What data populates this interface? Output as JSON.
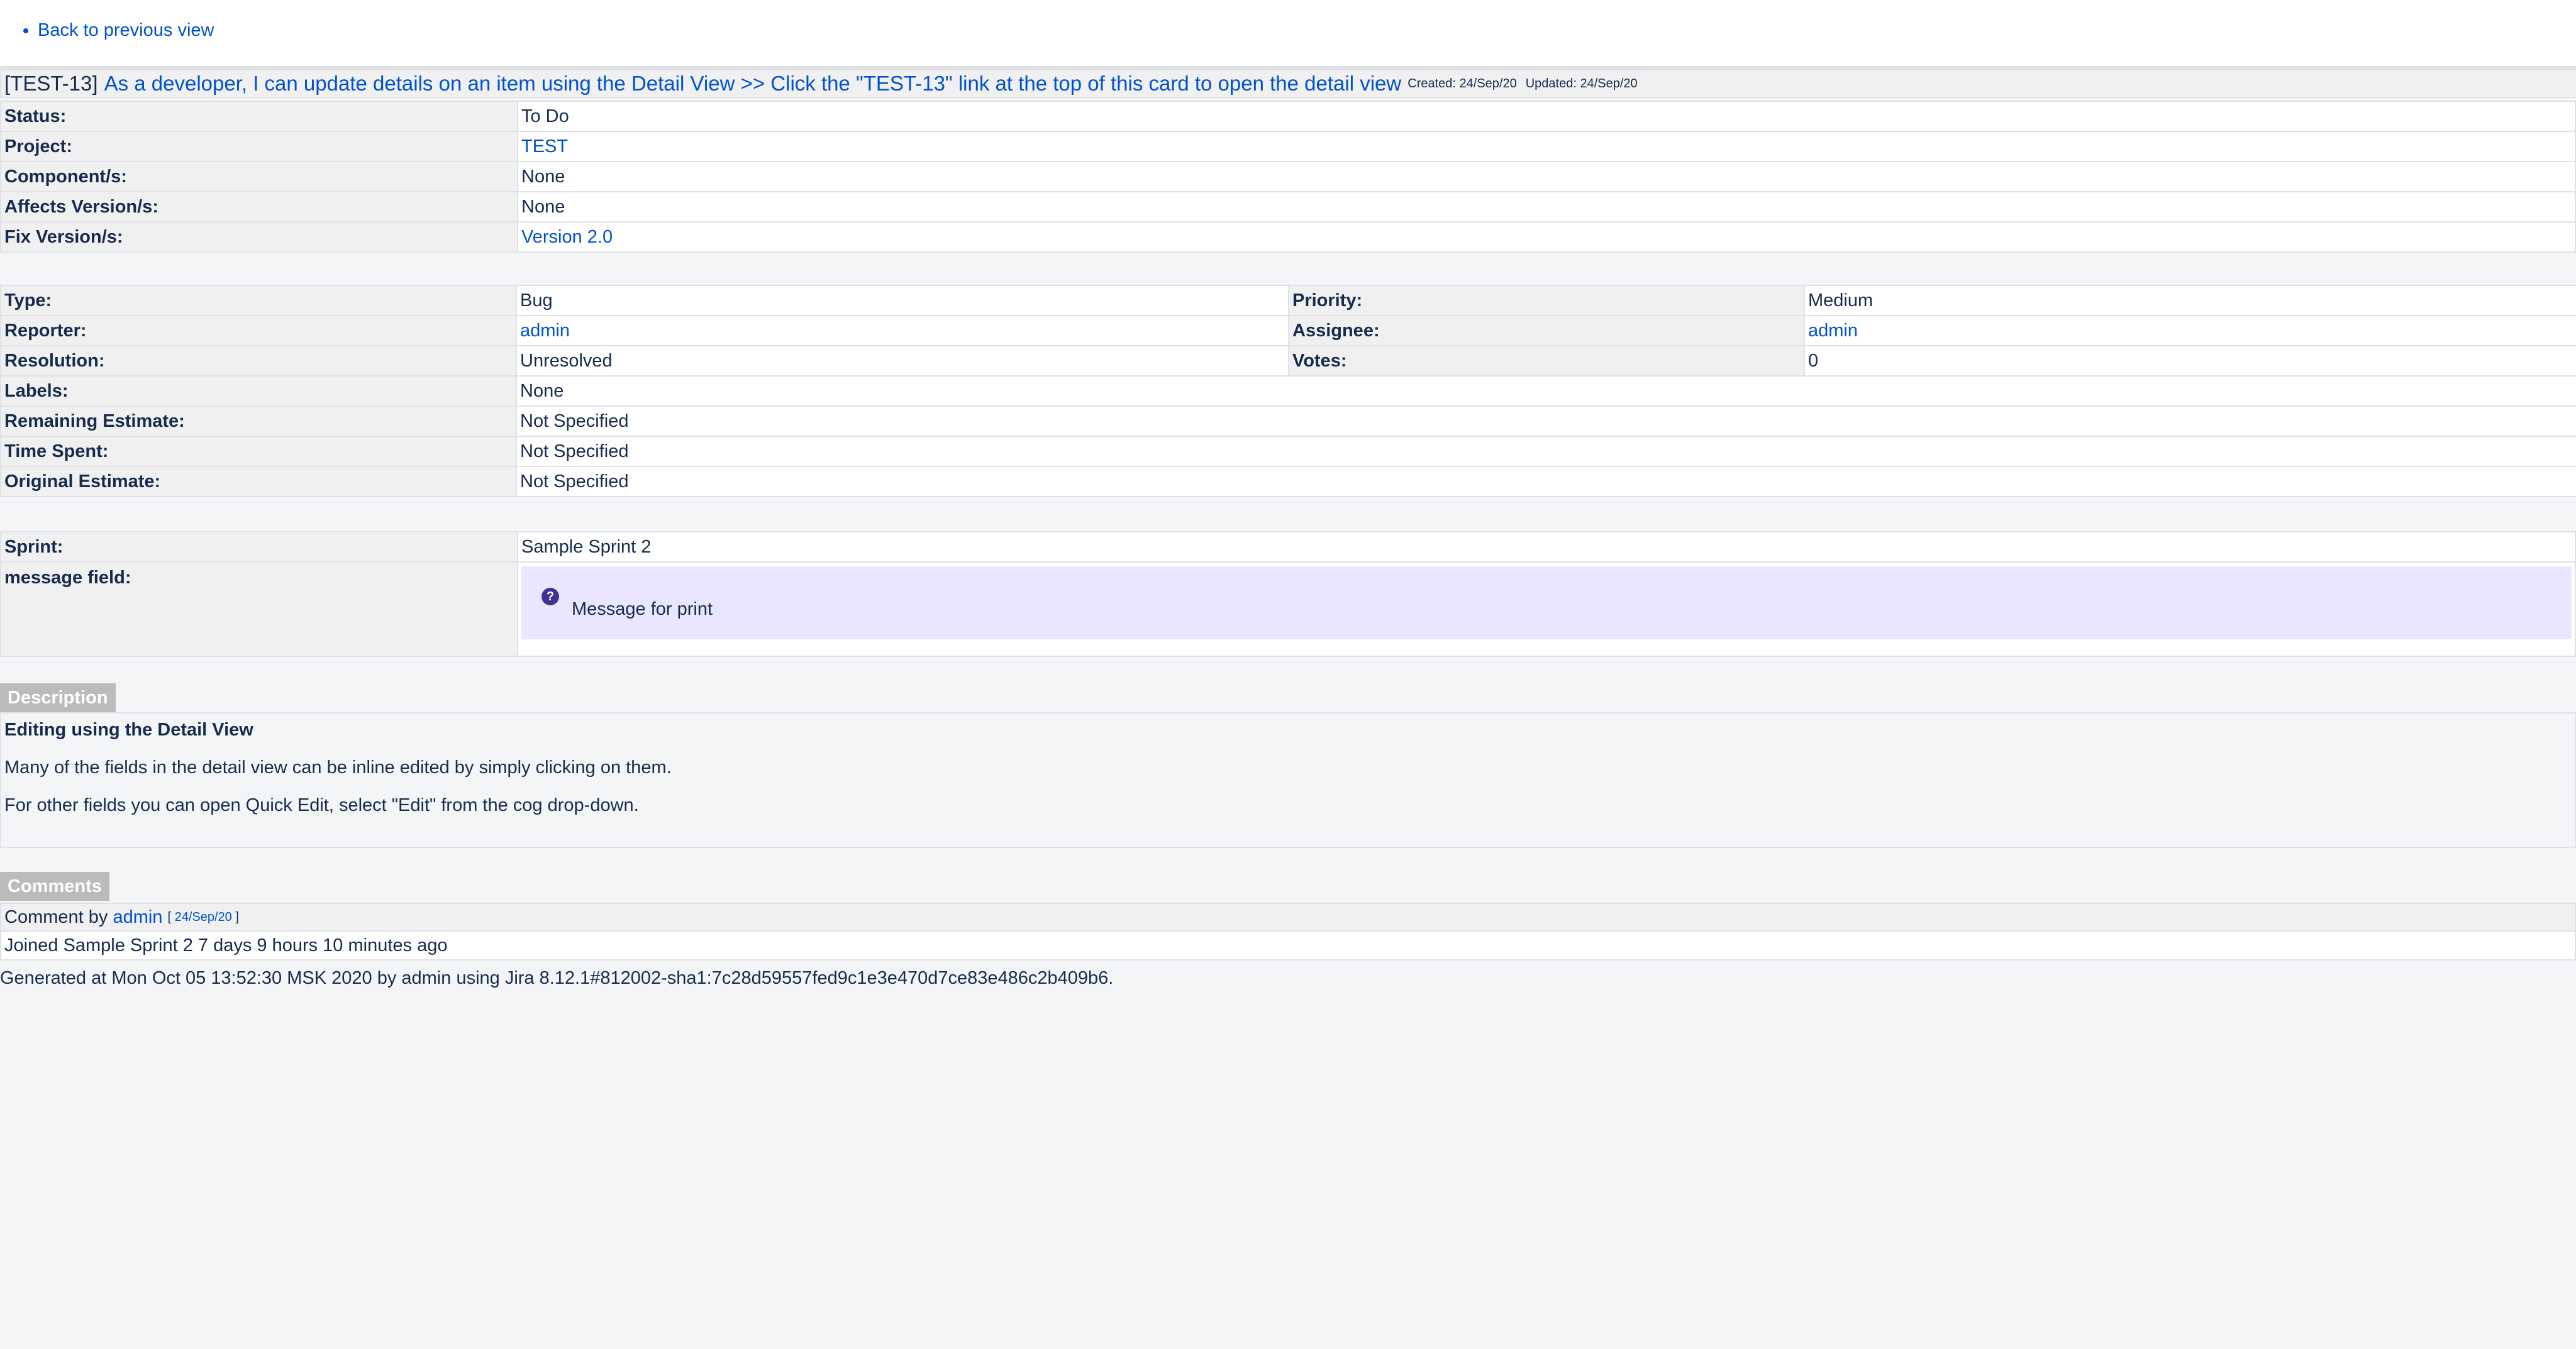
{
  "nav": {
    "back_label": "Back to previous view"
  },
  "issue": {
    "key": "[TEST-13]",
    "summary": "As a developer, I can update details on an item using the Detail View >> Click the \"TEST-13\" link at the top of this card to open the detail view",
    "created": "Created: 24/Sep/20",
    "updated": "Updated: 24/Sep/20"
  },
  "fields1": [
    {
      "label": "Status:",
      "value": "To Do"
    },
    {
      "label": "Project:",
      "value": "TEST"
    },
    {
      "label": "Component/s:",
      "value": "None"
    },
    {
      "label": "Affects Version/s:",
      "value": "None"
    },
    {
      "label": "Fix Version/s:",
      "value": "Version 2.0"
    }
  ],
  "fields2": {
    "type_label": "Type:",
    "type": "Bug",
    "priority_label": "Priority:",
    "priority": "Medium",
    "reporter_label": "Reporter:",
    "reporter": "admin",
    "assignee_label": "Assignee:",
    "assignee": "admin",
    "resolution_label": "Resolution:",
    "resolution": "Unresolved",
    "votes_label": "Votes:",
    "votes": "0",
    "labels_label": "Labels:",
    "labels": "None",
    "remaining_label": "Remaining Estimate:",
    "remaining": "Not Specified",
    "spent_label": "Time Spent:",
    "spent": "Not Specified",
    "original_label": "Original Estimate:",
    "original": "Not Specified"
  },
  "fields3": {
    "sprint_label": "Sprint:",
    "sprint": "Sample Sprint 2",
    "message_label": "message field:",
    "message_icon": "?",
    "message": "Message for print"
  },
  "description": {
    "tab": "Description",
    "heading": "Editing using the Detail View",
    "p1": "Many of the fields in the detail view can be inline edited by simply clicking on them.",
    "p2": "For other fields you can open Quick Edit, select \"Edit\" from the cog drop-down."
  },
  "comments": {
    "tab": "Comments",
    "by_label": "Comment by",
    "author": "admin",
    "open_bracket": "[",
    "date": "24/Sep/20",
    "close_bracket": "]",
    "body": "Joined Sample Sprint 2 7 days 9 hours 10 minutes ago"
  },
  "footer": "Generated at Mon Oct 05 13:52:30 MSK 2020 by admin using Jira 8.12.1#812002-sha1:7c28d59557fed9c1e3e470d7ce83e486c2b409b6.",
  "colors": {
    "link": "#0052cc",
    "label_bg": "#f0f0f0",
    "message_bg": "#eae6ff",
    "tab_bg": "#bbbbbb"
  }
}
